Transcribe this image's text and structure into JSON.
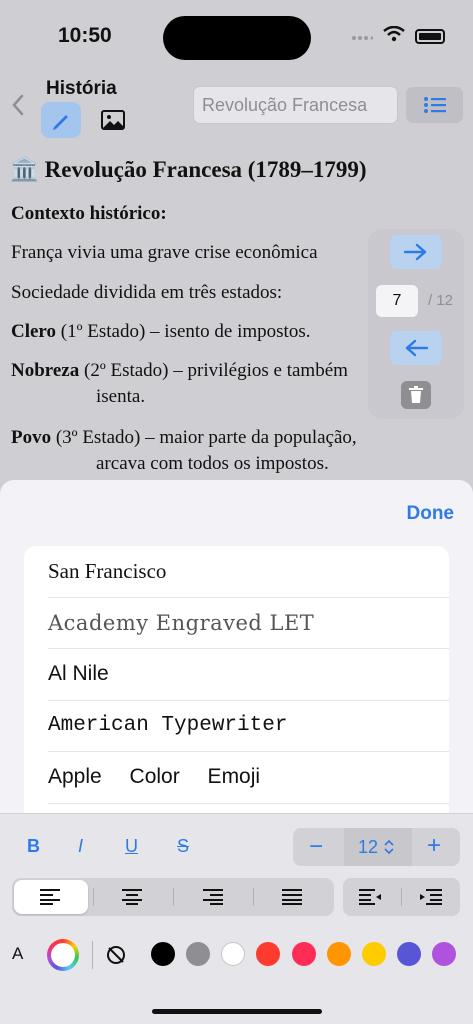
{
  "status": {
    "time": "10:50"
  },
  "nav": {
    "title": "História",
    "search_value": "Revolução Francesa"
  },
  "doc": {
    "title": "Revolução Francesa (1789–1799)",
    "title_emoji": "🏛️",
    "context_heading": "Contexto histórico:",
    "line1": "França vivia uma grave crise econômica",
    "line2": "Sociedade dividida em três estados:",
    "clero_bold": "Clero",
    "clero_rest": " (1º Estado) – isento de impostos.",
    "nobreza_bold": "Nobreza",
    "nobreza_rest": " (2º Estado) – privilégios e também",
    "nobreza_cont": "isenta.",
    "povo_bold": "Povo",
    "povo_rest": " (3º Estado) – maior parte da população,",
    "povo_cont": "arcava com todos os impostos."
  },
  "pager": {
    "current_page": "7",
    "total": "/ 12"
  },
  "sheet": {
    "done_label": "Done",
    "fonts": [
      "San Francisco",
      "Academy Engraved LET",
      "Al Nile",
      "American Typewriter",
      "Apple Color Emoji"
    ]
  },
  "toolbar": {
    "bold": "B",
    "italic": "I",
    "underline": "U",
    "strike": "S",
    "minus": "−",
    "font_size": "12",
    "plus": "+",
    "color_label": "A",
    "swatches": [
      "#000000",
      "#8e8e93",
      "#ffffff",
      "#ff3b30",
      "#ff2d55",
      "#ff9500",
      "#ffcc00",
      "#5856d6",
      "#af52de"
    ]
  },
  "colors": {
    "accent": "#2f7ae5"
  }
}
